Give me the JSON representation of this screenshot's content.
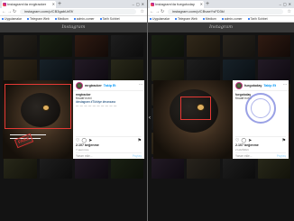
{
  "left_window": {
    "tab_title": "Instagram'da mrgtracker",
    "url": "instagram.com/p/CB3gabUrEf/",
    "bookmarks": [
      "Uygulamalar",
      "Telegram Web",
      "Medium",
      "admin-comer",
      "Tarih Sohbet",
      "Tarih Tracking"
    ],
    "post": {
      "username": "mrgtracker",
      "follow": "Takip Et",
      "comment_user": "mrgtracker",
      "comment_text": "Kruvat'ın evi",
      "tags_text": "#instagram #Türkiye #manzara",
      "dashes": "— — — — — — — — — —",
      "likes": "2.107 beğenme",
      "time": "7 saat önce",
      "add_comment": "Yorum ekle...",
      "post_label": "Paylaş",
      "stamp": "FAKE"
    }
  },
  "right_window": {
    "tab_title": "Instagram'da fuegotoday",
    "url": "instagram.com/p/CBvaeYsFD3k/",
    "bookmarks": [
      "Uygulamalar",
      "Telegram Web",
      "Medium",
      "admin-comer",
      "Tarih Sohbet",
      "Tarih Tracking"
    ],
    "post": {
      "username": "fuegotoday",
      "follow": "Takip Et",
      "comment_user": "fuegotoday",
      "comment_text": "Kruvat'ın evi",
      "likes": "2.107 beğenme",
      "time": "2 HAZİRAN",
      "add_comment": "Yorum ekle...",
      "post_label": "Paylaş"
    }
  },
  "ig": {
    "logo": "Instagram"
  },
  "icons": {
    "heart": "heart-icon",
    "comment": "comment-icon",
    "share": "share-icon",
    "save": "bookmark-icon",
    "more": "more-icon"
  }
}
